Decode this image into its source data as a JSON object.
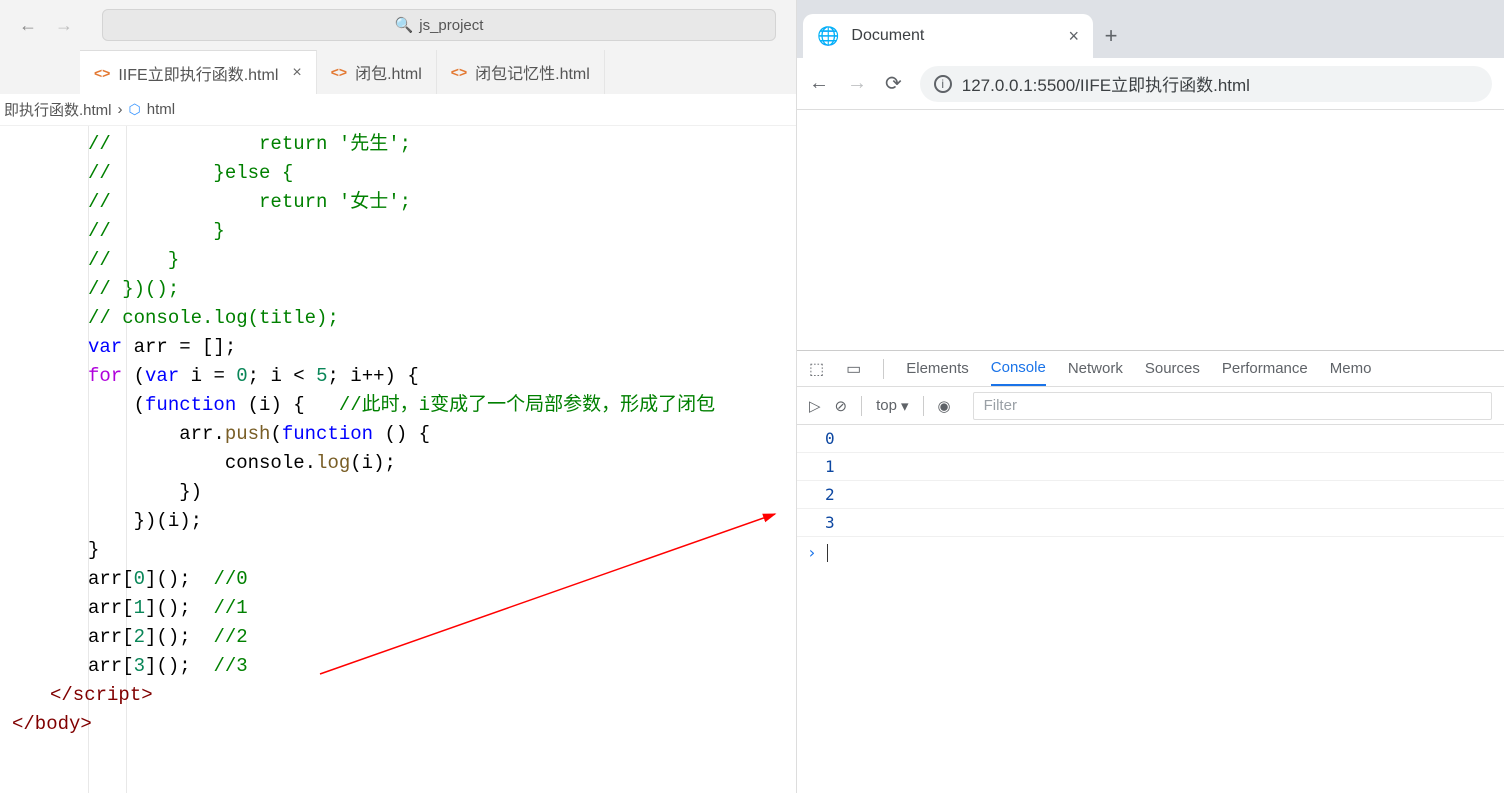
{
  "vscode": {
    "search_placeholder": "js_project",
    "tabs": [
      {
        "label": "IIFE立即执行函数.html",
        "active": true,
        "close": true
      },
      {
        "label": "闭包.html",
        "active": false,
        "close": false
      },
      {
        "label": "闭包记忆性.html",
        "active": false,
        "close": false
      }
    ],
    "breadcrumb": {
      "file": "即执行函数.html",
      "sep": "›",
      "symbol": "html"
    }
  },
  "code": {
    "l1": "//             return '先生';",
    "l2": "//         }else {",
    "l3": "//             return '女士';",
    "l4": "//         }",
    "l5": "//     }",
    "l6": "// })();",
    "l7": "// console.log(title);",
    "l8": "",
    "l9a": "var",
    "l9b": " arr = [];",
    "l10a": "for",
    "l10b": " (",
    "l10c": "var",
    "l10d": " i = ",
    "l10e": "0",
    "l10f": "; i < ",
    "l10g": "5",
    "l10h": "; i++) {",
    "l11a": "    (",
    "l11b": "function",
    "l11c": " (i) {   ",
    "l11d": "//此时，i变成了一个局部参数，形成了闭包",
    "l12a": "        arr.",
    "l12b": "push",
    "l12c": "(",
    "l12d": "function",
    "l12e": " () {",
    "l13a": "            console.",
    "l13b": "log",
    "l13c": "(i);",
    "l14": "        })",
    "l15": "    })(i);",
    "l16": "}",
    "l17a": "arr[",
    "l17b": "0",
    "l17c": "]();  ",
    "l17d": "//0",
    "l18a": "arr[",
    "l18b": "1",
    "l18c": "]();  ",
    "l18d": "//1",
    "l19a": "arr[",
    "l19b": "2",
    "l19c": "]();  ",
    "l19d": "//2",
    "l20a": "arr[",
    "l20b": "3",
    "l20c": "]();  ",
    "l20d": "//3",
    "l21": "</script>",
    "l22": "</body>"
  },
  "browser": {
    "tab_title": "Document",
    "url": "127.0.0.1:5500/IIFE立即执行函数.html"
  },
  "devtools": {
    "tabs": [
      "Elements",
      "Console",
      "Network",
      "Sources",
      "Performance",
      "Memo"
    ],
    "active_tab": "Console",
    "context": "top",
    "filter_placeholder": "Filter",
    "output": [
      "0",
      "1",
      "2",
      "3"
    ]
  }
}
